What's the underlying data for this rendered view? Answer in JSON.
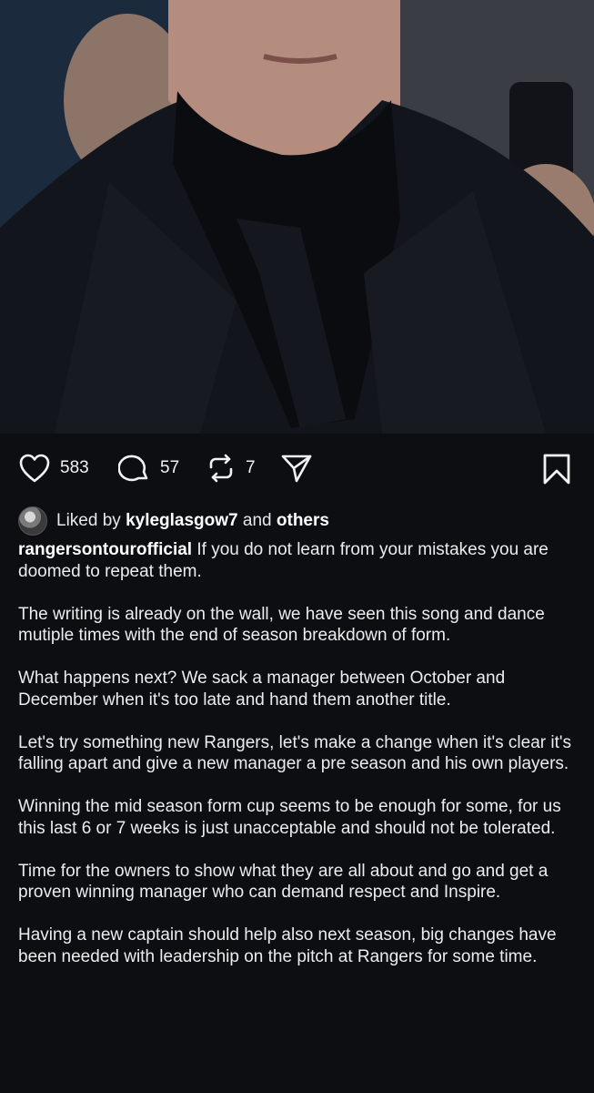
{
  "post": {
    "image_description_icon": "photo-of-man-in-dark-coat-and-scarf",
    "likes_count": "583",
    "comments_count": "57",
    "reposts_count": "7"
  },
  "liked_by": {
    "prefix": "Liked by",
    "user": "kyleglasgow7",
    "conjunction": "and",
    "others": "others"
  },
  "caption": {
    "username": "rangersontourofficial",
    "paragraphs": [
      "If you do not learn from your mistakes you are doomed to repeat them.",
      "The writing is already on the wall, we have seen this song and dance mutiple times with the end of season breakdown of form.",
      "What happens next? We sack a manager between October and December when it's too late and hand them another title.",
      "Let's try something new Rangers, let's make a change when it's clear it's falling apart and give a new manager a pre season and his own players.",
      "Winning the mid season form cup seems to be enough for some, for us this last 6 or 7 weeks is just unacceptable and should not be tolerated.",
      "Time for the owners to show what they are all about and go and get a proven winning manager who can demand respect and Inspire.",
      "Having a new captain should help also next season, big changes have been needed with leadership on the pitch at Rangers for some time."
    ]
  },
  "colors": {
    "background": "#0c0e12",
    "text": "#f2f2f2"
  }
}
